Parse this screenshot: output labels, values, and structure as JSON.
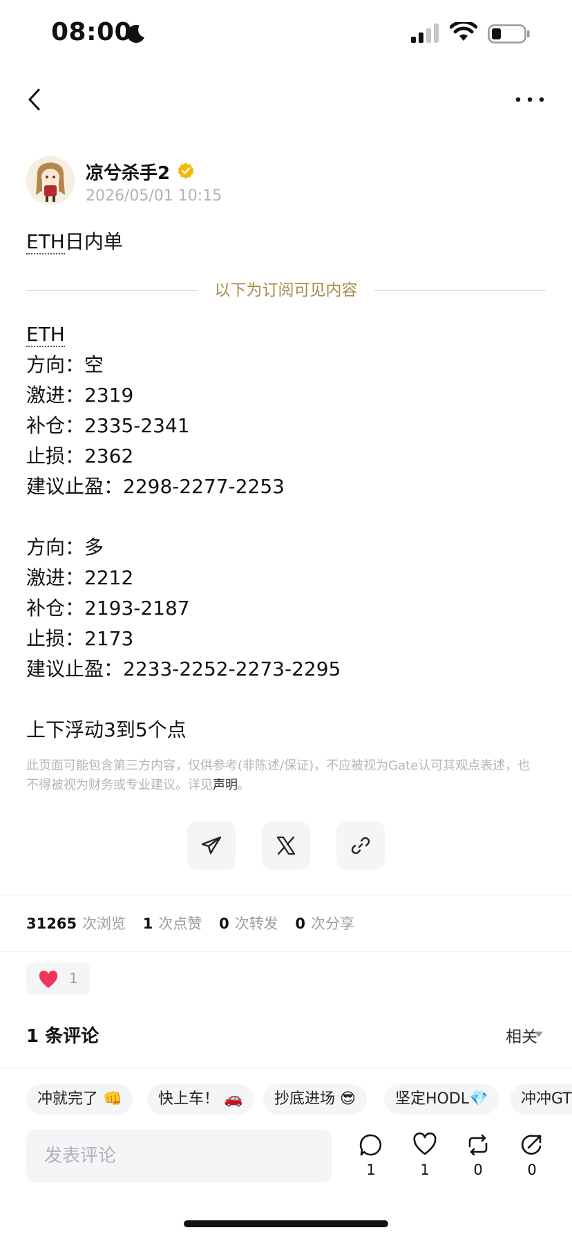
{
  "status_bar": {
    "time": "08:00"
  },
  "author": {
    "name": "凉兮杀手2",
    "time": "2026/05/01 10:15"
  },
  "post": {
    "title_prefix": "ETH",
    "title_suffix": "日内单",
    "divider_text": "以下为订阅可见内容",
    "symbol": "ETH",
    "lines": [
      "方向：空",
      "激进：2319",
      "补仓：2335-2341",
      "止损：2362",
      "建议止盈：2298-2277-2253",
      "方向：多",
      "激进：2212",
      "补仓：2193-2187",
      "止损：2173",
      "建议止盈：2233-2252-2273-2295",
      "上下浮动3到5个点"
    ],
    "disclaimer": "此页面可能包含第三方内容，仅供参考(非陈述/保证)，不应被视为Gate认可其观点表述，也不得被视为财务或专业建议。详见",
    "disclaimer_link": "声明",
    "disclaimer_end": "。"
  },
  "share": {
    "icons": [
      "telegram-icon",
      "x-icon",
      "link-icon"
    ]
  },
  "stats": {
    "views": "31265",
    "views_label": "次浏览",
    "likes": "1",
    "likes_label": "次点赞",
    "reposts": "0",
    "reposts_label": "次转发",
    "shares": "0",
    "shares_label": "次分享"
  },
  "reaction": {
    "count": "1"
  },
  "comments": {
    "title": "1 条评论",
    "sort": "相关"
  },
  "quick_replies": [
    "冲就完了 👊",
    "快上车！ 🚗",
    "抄底进场 😎",
    "坚定HODL💎",
    "冲冲GT"
  ],
  "comment_input": {
    "placeholder": "发表评论"
  },
  "actions": {
    "comment": "1",
    "like": "1",
    "repost": "0",
    "share": "0"
  },
  "colors": {
    "accent_gold": "#a88a4a",
    "heart": "#f0345a",
    "verified": "#f5b800"
  }
}
